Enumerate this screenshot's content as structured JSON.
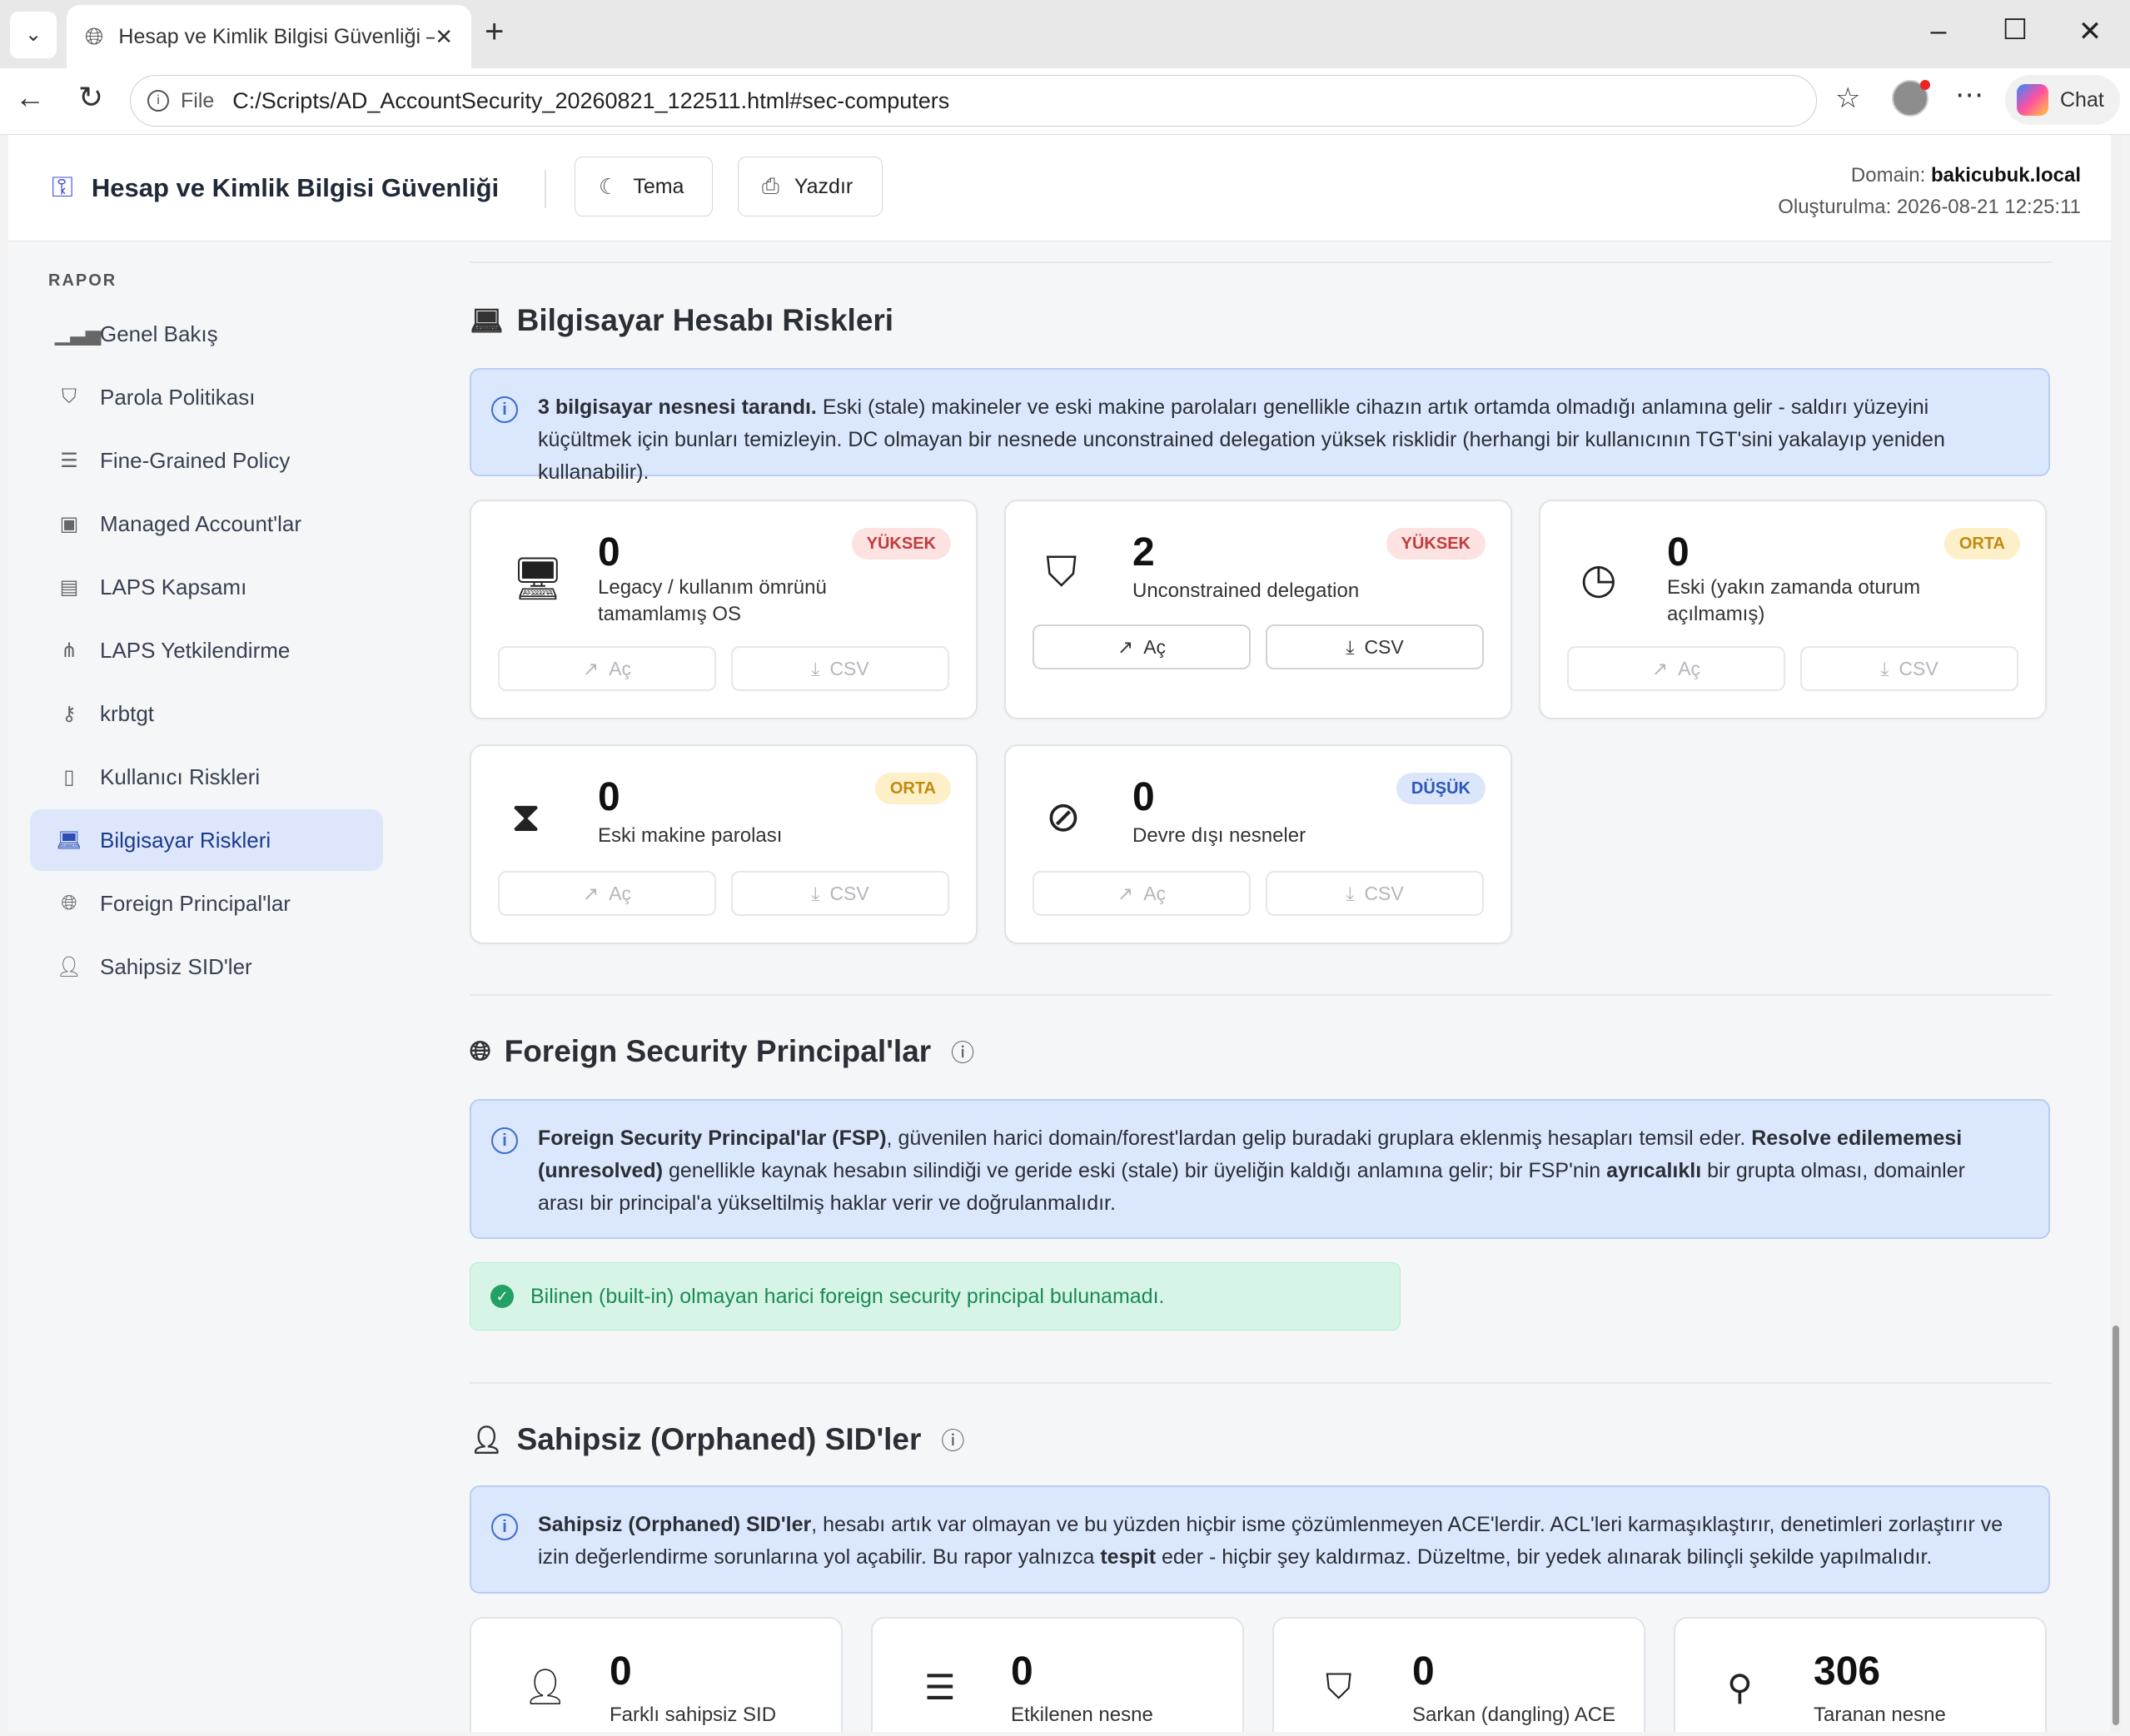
{
  "browser": {
    "tab_title": "Hesap ve Kimlik Bilgisi Güvenliği – ",
    "url_scheme": "File",
    "url": "C:/Scripts/AD_AccountSecurity_20260821_122511.html#sec-computers",
    "chat_label": "Chat"
  },
  "header": {
    "title": "Hesap ve Kimlik Bilgisi Güvenliği",
    "theme_label": "Tema",
    "print_label": "Yazdır",
    "domain_label": "Domain:",
    "domain_value": "bakicubuk.local",
    "created_label": "Oluşturulma:",
    "created_value": "2026-08-21 12:25:11"
  },
  "sidebar": {
    "heading": "RAPOR",
    "items": [
      {
        "label": "Genel Bakış",
        "icon": "bar-chart-icon"
      },
      {
        "label": "Parola Politikası",
        "icon": "shield-icon"
      },
      {
        "label": "Fine-Grained Policy",
        "icon": "sliders-icon"
      },
      {
        "label": "Managed Account'lar",
        "icon": "robot-icon"
      },
      {
        "label": "LAPS Kapsamı",
        "icon": "device-icon"
      },
      {
        "label": "LAPS Yetkilendirme",
        "icon": "hierarchy-icon"
      },
      {
        "label": "krbtgt",
        "icon": "key-icon"
      },
      {
        "label": "Kullanıcı Riskleri",
        "icon": "user-badge-icon"
      },
      {
        "label": "Bilgisayar Riskleri",
        "icon": "laptop-icon"
      },
      {
        "label": "Foreign Principal'lar",
        "icon": "globe-icon"
      },
      {
        "label": "Sahipsiz SID'ler",
        "icon": "user-slash-icon"
      }
    ]
  },
  "computers": {
    "title": "Bilgisayar Hesabı Riskleri",
    "info_bold": "3 bilgisayar nesnesi tarandı.",
    "info_text": " Eski (stale) makineler ve eski makine parolaları genellikle cihazın artık ortamda olmadığı anlamına gelir - saldırı yüzeyini küçültmek için bunları temizleyin. DC olmayan bir nesnede unconstrained delegation yüksek risklidir (herhangi bir kullanıcının TGT'sini yakalayıp yeniden kullanabilir).",
    "open_label": "Aç",
    "csv_label": "CSV",
    "cards": [
      {
        "value": "0",
        "label": "Legacy / kullanım ömrünü tamamlamış OS",
        "badge": "YÜKSEK",
        "icon": "desktop-icon"
      },
      {
        "value": "2",
        "label": "Unconstrained delegation",
        "badge": "YÜKSEK",
        "icon": "shield-alert-icon"
      },
      {
        "value": "0",
        "label": "Eski (yakın zamanda oturum açılmamış)",
        "badge": "ORTA",
        "icon": "clock-icon"
      },
      {
        "value": "0",
        "label": "Eski makine parolası",
        "badge": "ORTA",
        "icon": "hourglass-icon"
      },
      {
        "value": "0",
        "label": "Devre dışı nesneler",
        "badge": "DÜŞÜK",
        "icon": "ban-icon"
      }
    ]
  },
  "foreign": {
    "title": "Foreign Security Principal'lar",
    "info_b1": "Foreign Security Principal'lar (FSP)",
    "info_t1": ", güvenilen harici domain/forest'lardan gelip buradaki gruplara eklenmiş hesapları temsil eder. ",
    "info_b2": "Resolve edilememesi (unresolved)",
    "info_t2": " genellikle kaynak hesabın silindiği ve geride eski (stale) bir üyeliğin kaldığı anlamına gelir; bir FSP'nin ",
    "info_b3": "ayrıcalıklı",
    "info_t3": " bir grupta olması, domainler arası bir principal'a yükseltilmiş haklar verir ve doğrulanmalıdır.",
    "ok_text": "Bilinen (built-in) olmayan harici foreign security principal bulunamadı."
  },
  "orphaned": {
    "title": "Sahipsiz (Orphaned) SID'ler",
    "info_b1": "Sahipsiz (Orphaned) SID'ler",
    "info_t1": ", hesabı artık var olmayan ve bu yüzden hiçbir isme çözümlenmeyen ACE'lerdir. ACL'leri karmaşıklaştırır, denetimleri zorlaştırır ve izin değerlendirme sorunlarına yol açabilir. Bu rapor yalnızca ",
    "info_b2": "tespit",
    "info_t2": " eder - hiçbir şey kaldırmaz. Düzeltme, bir yedek alınarak bilinçli şekilde yapılmalıdır.",
    "stats": [
      {
        "value": "0",
        "label": "Farklı sahipsiz SID",
        "icon": "user-dot-icon"
      },
      {
        "value": "0",
        "label": "Etkilenen nesne",
        "icon": "layers-icon"
      },
      {
        "value": "0",
        "label": "Sarkan (dangling) ACE",
        "icon": "shield-off-icon"
      },
      {
        "value": "306",
        "label": "Taranan nesne",
        "icon": "search-icon"
      }
    ]
  }
}
